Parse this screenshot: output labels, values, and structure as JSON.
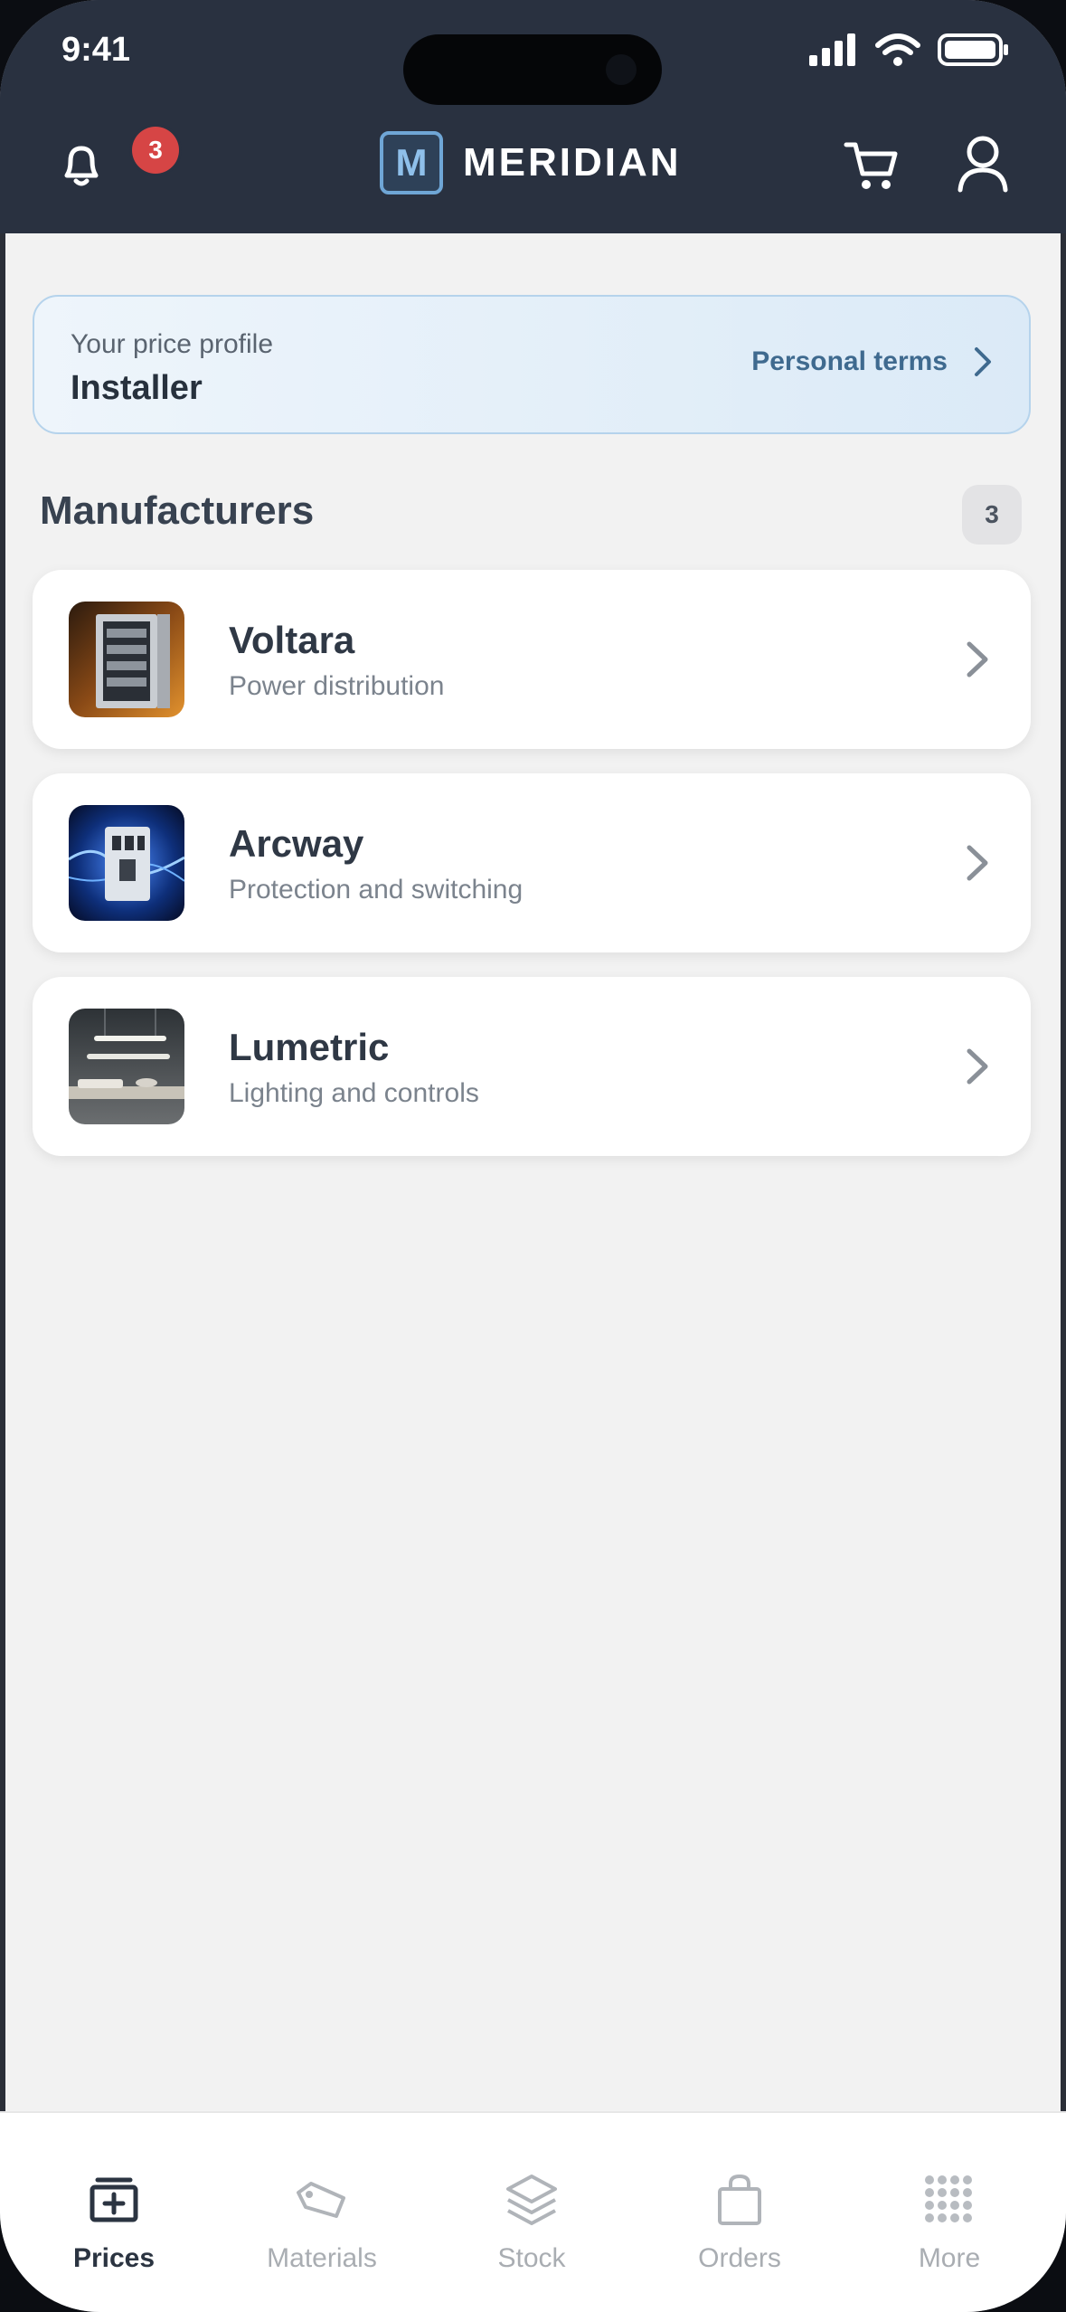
{
  "status_bar": {
    "time": "9:41"
  },
  "header": {
    "notifications_count": "3",
    "logo_letter": "M",
    "brand": "MERIDIAN"
  },
  "price_profile": {
    "label": "Your price profile",
    "value": "Installer",
    "link": "Personal terms"
  },
  "manufacturers": {
    "title": "Manufacturers",
    "count": "3",
    "items": [
      {
        "name": "Voltara",
        "description": "Power distribution"
      },
      {
        "name": "Arcway",
        "description": "Protection and switching"
      },
      {
        "name": "Lumetric",
        "description": "Lighting and controls"
      }
    ]
  },
  "bottom_nav": {
    "items": [
      {
        "label": "Prices",
        "icon": "price-list-icon",
        "active": true
      },
      {
        "label": "Materials",
        "icon": "tag-icon",
        "active": false
      },
      {
        "label": "Stock",
        "icon": "layers-icon",
        "active": false
      },
      {
        "label": "Orders",
        "icon": "shopping-bag-icon",
        "active": false
      },
      {
        "label": "More",
        "icon": "grid-dots-icon",
        "active": false
      }
    ]
  },
  "colors": {
    "header_bg": "#293140",
    "accent": "#3f6a8f",
    "badge": "#d64545",
    "page_bg": "#f2f2f2"
  }
}
